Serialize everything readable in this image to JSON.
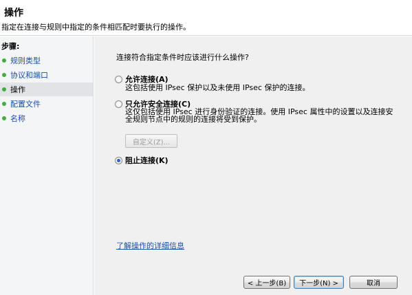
{
  "header": {
    "title": "操作",
    "description": "指定在连接与规则中指定的条件相匹配时要执行的操作。"
  },
  "sidebar": {
    "heading": "步骤:",
    "items": [
      {
        "label": "规则类型"
      },
      {
        "label": "协议和端口"
      },
      {
        "label": "操作",
        "selected": true
      },
      {
        "label": "配置文件"
      },
      {
        "label": "名称"
      }
    ]
  },
  "main": {
    "question": "连接符合指定条件时应该进行什么操作?",
    "options": [
      {
        "label": "允许连接(A)",
        "desc": "这包括使用 IPsec 保护以及未使用 IPsec 保护的连接。",
        "checked": false
      },
      {
        "label": "只允许安全连接(C)",
        "desc_line1": "这仅包括使用 IPsec 进行身份验证的连接。使用 IPsec 属性中的设置以及连接安",
        "desc_line2": "全规则节点中的规则的连接将受到保护。",
        "checked": false
      },
      {
        "label": "阻止连接(K)",
        "checked": true
      }
    ],
    "custom_button": "自定义(Z)...",
    "learn_link": "了解操作的详细信息"
  },
  "footer": {
    "back": "< 上一步(B)",
    "next": "下一步(N) >",
    "cancel": "取消"
  },
  "colors": {
    "link": "#1a4fa6",
    "step_dot": "#3fae3b",
    "sidebar_bg": "#f4f5f7",
    "main_bg": "#f0f0f0"
  }
}
